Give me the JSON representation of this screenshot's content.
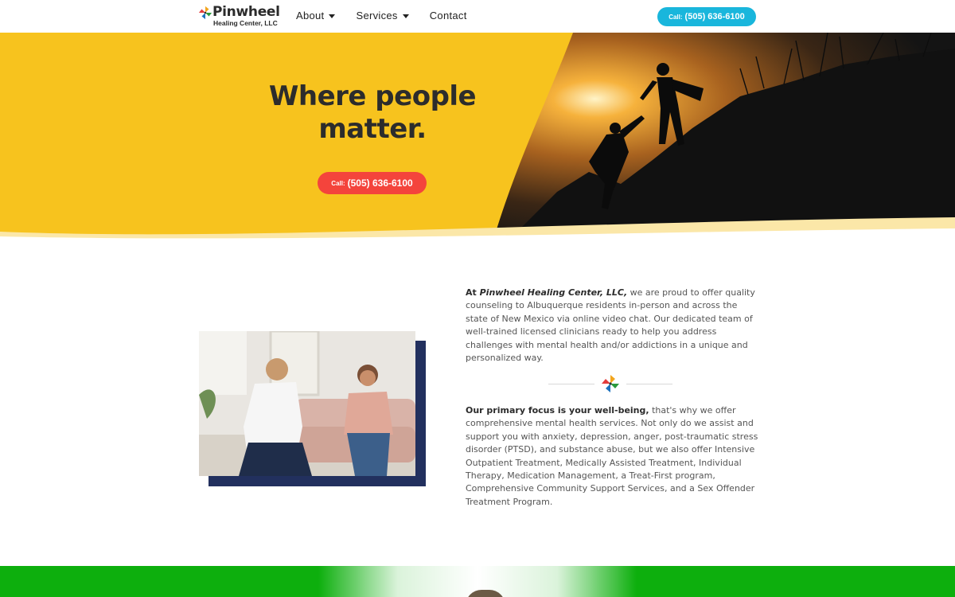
{
  "brand": {
    "name": "Pinwheel",
    "subtitle": "Healing Center, LLC"
  },
  "nav": {
    "items": [
      {
        "label": "About",
        "has_dropdown": true
      },
      {
        "label": "Services",
        "has_dropdown": true
      },
      {
        "label": "Contact",
        "has_dropdown": false
      }
    ]
  },
  "header_cta": {
    "prefix": "Call:",
    "phone": "(505) 636-6100"
  },
  "hero": {
    "title": "Where people matter.",
    "cta_prefix": "Call:",
    "cta_phone": "(505) 636-6100"
  },
  "intro": {
    "lead": "At ",
    "org": "Pinwheel Healing Center, LLC,",
    "body": " we are proud to offer quality counseling to Albuquerque residents in-person and across the state of New Mexico via online video chat. Our dedicated team of well-trained licensed clinicians ready to help you address challenges with mental health and/or addictions in a unique and personalized way."
  },
  "focus": {
    "lead": "Our primary focus is your well-being,",
    "body": " that's why we offer comprehensive mental health services. Not only do we assist and support you with anxiety, depression, anger, post-traumatic stress disorder (PTSD), and substance abuse, but we also offer Intensive Outpatient Treatment, Medically Assisted Treatment, Individual Therapy, Medication Management, a Treat-First program, Comprehensive Community Support Services, and a Sex Offender Treatment Program."
  },
  "colors": {
    "hero_yellow": "#f7c31e",
    "header_cta": "#19b6dc",
    "hero_cta": "#f4443c",
    "photo_accent": "#22305e",
    "band_green": "#0daf0d"
  },
  "icons": [
    "pinwheel-logo-icon",
    "chevron-down-icon",
    "pinwheel-divider-icon"
  ]
}
